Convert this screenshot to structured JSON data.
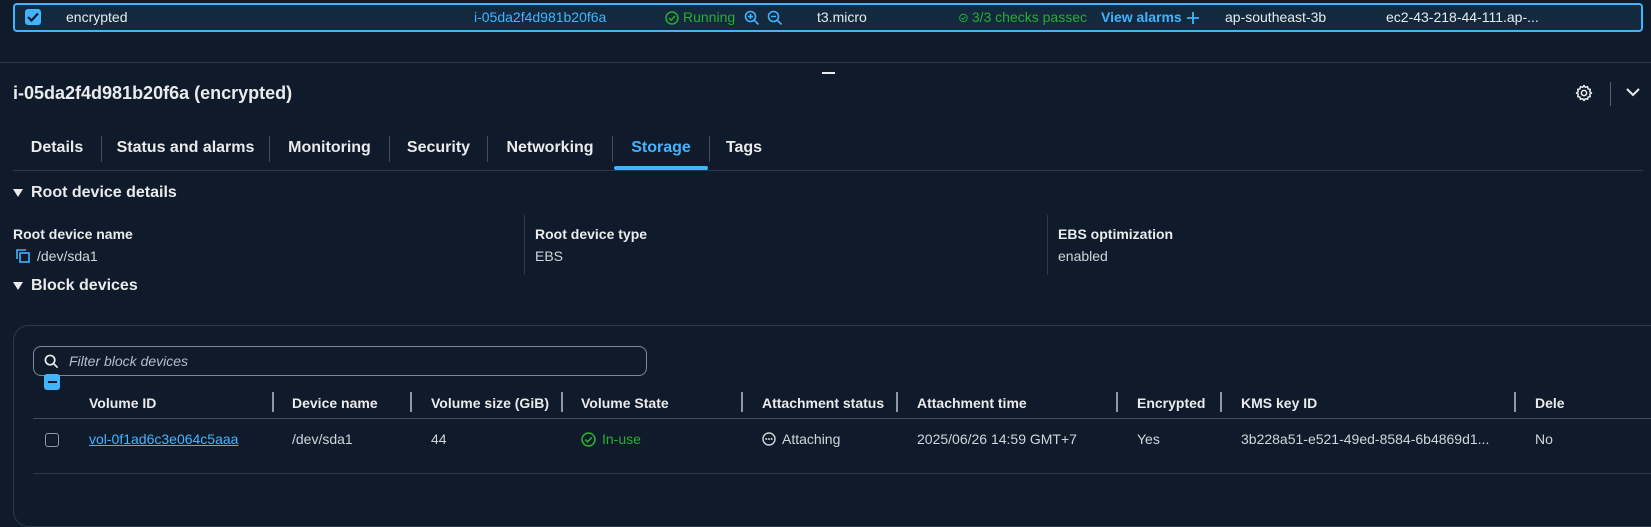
{
  "instance_row": {
    "name": "encrypted",
    "instance_id": "i-05da2f4d981b20f6a",
    "state": "Running",
    "type": "t3.micro",
    "checks": "3/3 checks passec",
    "alarms_link": "View alarms",
    "az": "ap-southeast-3b",
    "dns": "ec2-43-218-44-111.ap-..."
  },
  "details_title": "i-05da2f4d981b20f6a (encrypted)",
  "tabs": [
    {
      "label": "Details"
    },
    {
      "label": "Status and alarms"
    },
    {
      "label": "Monitoring"
    },
    {
      "label": "Security"
    },
    {
      "label": "Networking"
    },
    {
      "label": "Storage"
    },
    {
      "label": "Tags"
    }
  ],
  "active_tab": "Storage",
  "root_device": {
    "heading": "Root device details",
    "name_label": "Root device name",
    "name_value": "/dev/sda1",
    "type_label": "Root device type",
    "type_value": "EBS",
    "ebs_label": "EBS optimization",
    "ebs_value": "enabled"
  },
  "block_devices": {
    "heading": "Block devices",
    "filter_placeholder": "Filter block devices",
    "columns": [
      "Volume ID",
      "Device name",
      "Volume size (GiB)",
      "Volume State",
      "Attachment status",
      "Attachment time",
      "Encrypted",
      "KMS key ID",
      "Dele"
    ],
    "rows": [
      {
        "volume_id": "vol-0f1ad6c3e064c5aaa",
        "device_name": "/dev/sda1",
        "size": "44",
        "state": "In-use",
        "attachment_status": "Attaching",
        "attachment_time": "2025/06/26 14:59 GMT+7",
        "encrypted": "Yes",
        "kms_key": "3b228a51-e521-49ed-8584-6b4869d1...",
        "delete": "No"
      }
    ]
  },
  "colors": {
    "background": "#0f1b2a",
    "accent": "#42b4ff",
    "success": "#29ad32"
  }
}
